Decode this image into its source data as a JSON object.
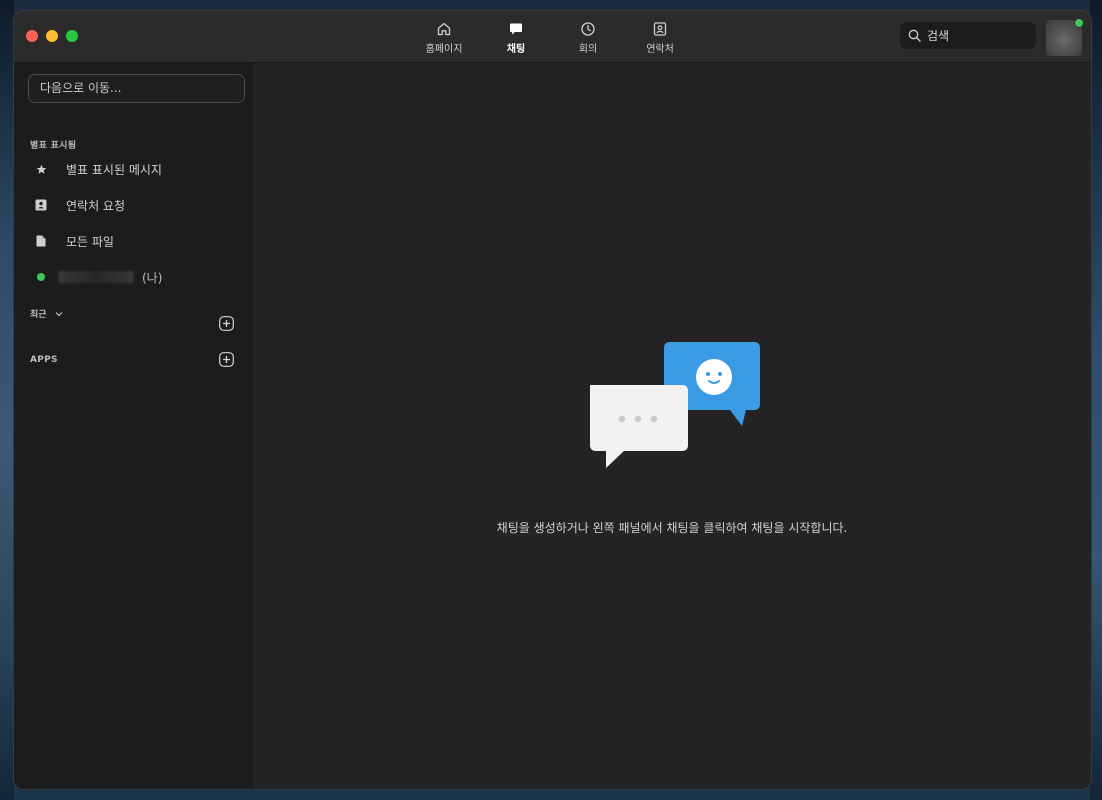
{
  "nav": {
    "tabs": [
      {
        "label": "홈페이지",
        "icon": "home-icon"
      },
      {
        "label": "채팅",
        "icon": "chat-icon",
        "active": true
      },
      {
        "label": "회의",
        "icon": "clock-icon"
      },
      {
        "label": "연락처",
        "icon": "contacts-icon"
      }
    ]
  },
  "search": {
    "placeholder": "검색"
  },
  "sidebar": {
    "goto_placeholder": "다음으로 이동...",
    "starred_section": "별표 표시됨",
    "items": [
      {
        "label": "별표 표시된 메시지",
        "icon": "star-icon"
      },
      {
        "label": "연락처 요청",
        "icon": "contact-card-icon"
      },
      {
        "label": "모든 파일",
        "icon": "file-icon"
      }
    ],
    "self_suffix": "(나)",
    "recent_label": "최근",
    "apps_label": "APPS"
  },
  "main": {
    "empty_message": "채팅을 생성하거나 왼쪽 패널에서 채팅을 클릭하여 채팅을 시작합니다."
  },
  "colors": {
    "accent_blue": "#3a9be4",
    "online_green": "#3ec85a"
  }
}
